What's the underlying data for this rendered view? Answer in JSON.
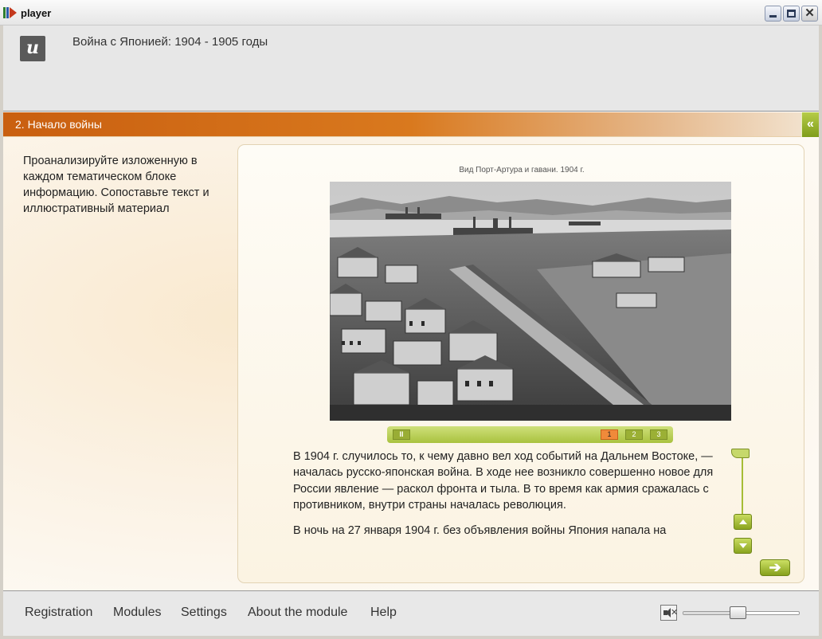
{
  "window": {
    "title": "player",
    "app_icon": "player-app-icon",
    "controls": {
      "minimize_icon": "minimize-icon",
      "maximize_icon": "maximize-icon",
      "close_icon": "close-icon",
      "close_glyph": "✕"
    }
  },
  "header": {
    "logo_text": "и",
    "course_title": "Война с Японией: 1904 - 1905 годы"
  },
  "section": {
    "title": "2. Начало войны",
    "collapse_glyph": "«"
  },
  "instructions": "Проанализируйте изложенную в каждом тематическом блоке информацию. Сопоставьте текст и иллюстративный материал",
  "slide": {
    "caption": "Вид Порт-Артура и гавани. 1904 г.",
    "image_icon": "historic-photo-port-arthur",
    "pause_label": "II",
    "pages": [
      {
        "label": "1",
        "active": true
      },
      {
        "label": "2",
        "active": false
      },
      {
        "label": "3",
        "active": false
      }
    ],
    "paragraphs": [
      "В 1904 г. случилось то, к чему давно вел ход событий на Дальнем Востоке, — началась русско-японская война. В ходе нее возникло совершенно новое для России явление — раскол фронта и тыла. В то время как армия сражалась с противником, внутри страны началась революция.",
      "В ночь на 27 января 1904 г. без объявления войны Япония напала на"
    ],
    "next_glyph": "➔"
  },
  "nav": {
    "registration": "Registration",
    "modules": "Modules",
    "settings": "Settings",
    "about": "About the module",
    "help": "Help"
  },
  "volume": {
    "icon": "speaker-muted-icon",
    "mute_glyph": "✕",
    "level": 0.5
  },
  "colors": {
    "section_bar": "#d9791e",
    "accent_green": "#a9c23f",
    "active_page": "#f08a3a"
  }
}
